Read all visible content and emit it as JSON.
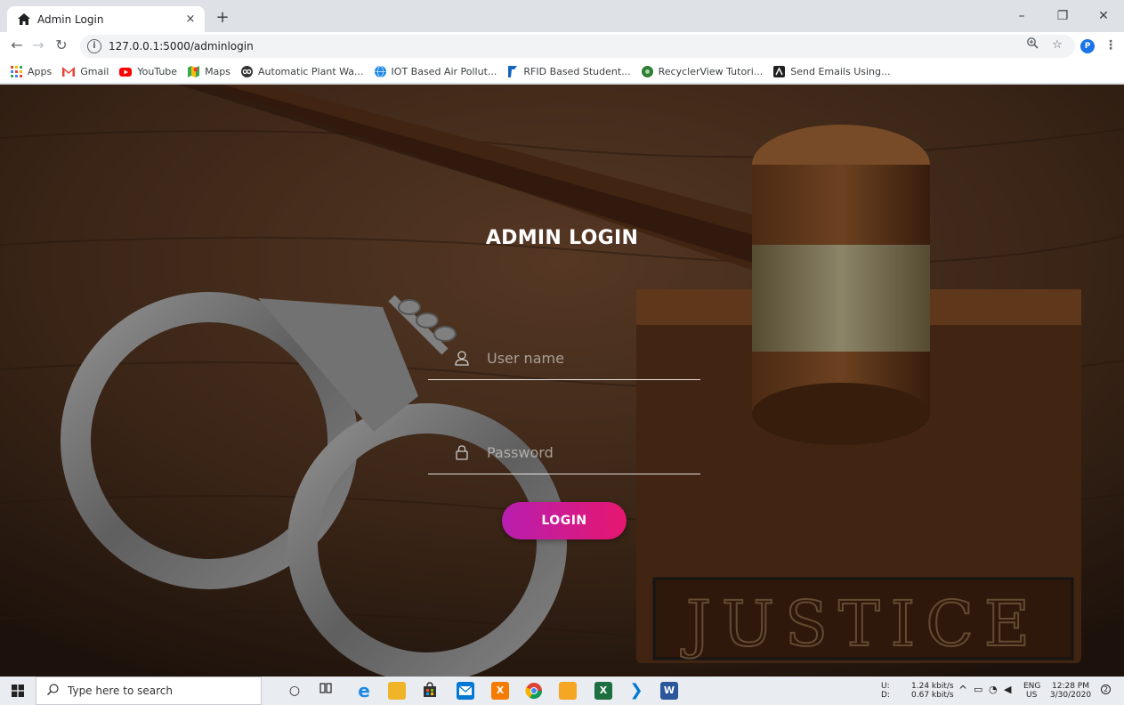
{
  "browser": {
    "tab_title": "Admin Login",
    "tab_close": "×",
    "new_tab": "+",
    "url": "127.0.0.1:5000/adminlogin",
    "profile_initial": "P",
    "window_controls": {
      "minimize": "–",
      "restore": "❐",
      "close": "✕"
    }
  },
  "bookmarks": [
    {
      "label": "Apps",
      "icon": "apps-grid-icon",
      "color": "#ea4335"
    },
    {
      "label": "Gmail",
      "icon": "gmail-icon",
      "color": "#ea4335"
    },
    {
      "label": "YouTube",
      "icon": "youtube-icon",
      "color": "#ff0000"
    },
    {
      "label": "Maps",
      "icon": "maps-icon",
      "color": "#34a853"
    },
    {
      "label": "Automatic Plant Wa...",
      "icon": "plant-site-icon",
      "color": "#333333"
    },
    {
      "label": "IOT Based Air Pollut...",
      "icon": "globe-icon",
      "color": "#1e88e5"
    },
    {
      "label": "RFID Based Student...",
      "icon": "rfid-site-icon",
      "color": "#1565c0"
    },
    {
      "label": "RecyclerView Tutori...",
      "icon": "recycler-site-icon",
      "color": "#2e7d32"
    },
    {
      "label": "Send Emails Using...",
      "icon": "email-site-icon",
      "color": "#212121"
    }
  ],
  "login": {
    "title": "ADMIN LOGIN",
    "username_placeholder": "User name",
    "password_placeholder": "Password",
    "button_label": "LOGIN",
    "accent_start": "#b81eb0",
    "accent_end": "#e6176f"
  },
  "taskbar": {
    "search_placeholder": "Type here to search",
    "network_up_label": "U:",
    "network_down_label": "D:",
    "network_up": "1.24 kbit/s",
    "network_down": "0.67 kbit/s",
    "language": "ENG",
    "region": "US",
    "time": "12:28 PM",
    "date": "3/30/2020",
    "notification_count": "2"
  }
}
